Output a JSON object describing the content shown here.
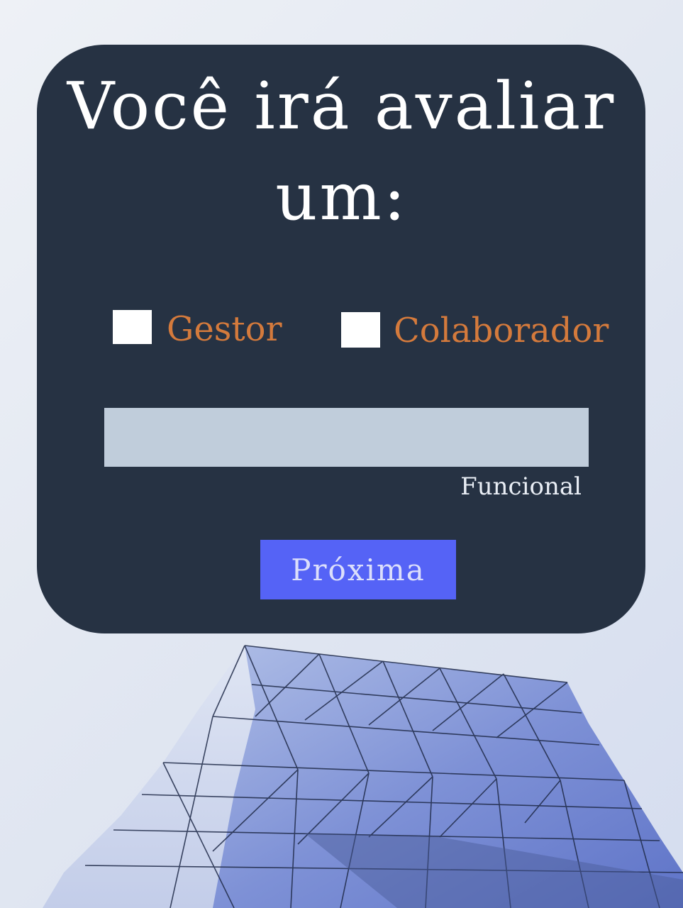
{
  "form": {
    "title_line1": "Você irá avaliar",
    "title_line2": "um:",
    "options": [
      {
        "label": "Gestor",
        "checked": false
      },
      {
        "label": "Colaborador",
        "checked": false
      }
    ],
    "input_value": "",
    "input_helper": "Funcional",
    "next_label": "Próxima"
  },
  "colors": {
    "card_background": "#263243",
    "option_label": "#d47a3c",
    "input_background": "#c0cddb",
    "button_background": "#5563f6"
  },
  "icons": {
    "background": "architecture-photo"
  }
}
